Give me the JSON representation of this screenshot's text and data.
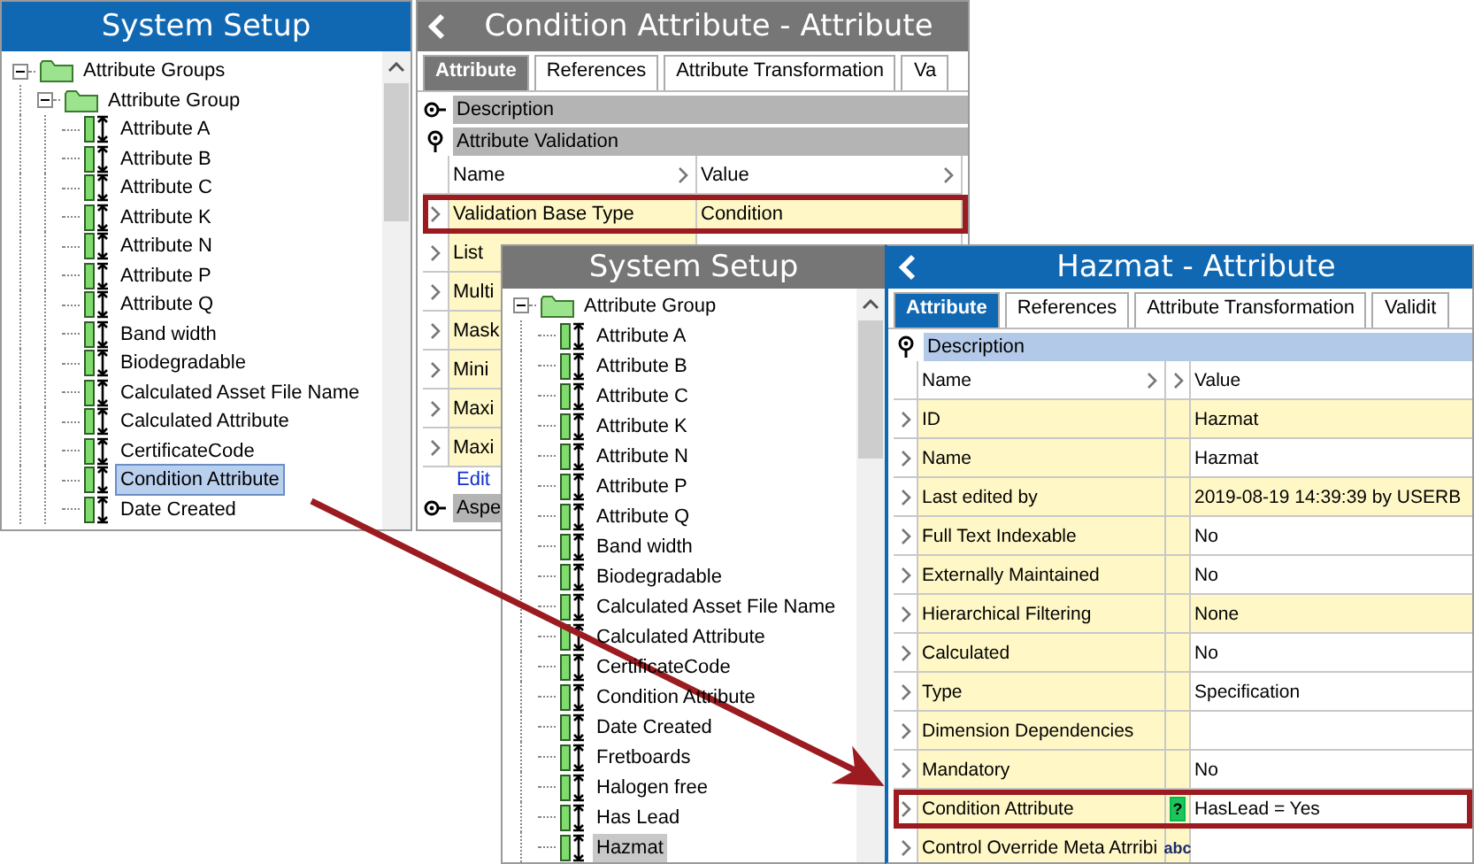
{
  "top_tree": {
    "title": "System Setup",
    "focused": true,
    "items": [
      {
        "kind": "group",
        "label": "Attribute Groups",
        "expanded": true,
        "children": [
          {
            "kind": "group",
            "label": "Attribute Group",
            "expanded": true,
            "children": [
              {
                "kind": "attribute",
                "label": "Attribute A",
                "selected": false
              },
              {
                "kind": "attribute",
                "label": "Attribute B",
                "selected": false
              },
              {
                "kind": "attribute",
                "label": "Attribute C",
                "selected": false
              },
              {
                "kind": "attribute",
                "label": "Attribute K",
                "selected": false
              },
              {
                "kind": "attribute",
                "label": "Attribute N",
                "selected": false
              },
              {
                "kind": "attribute",
                "label": "Attribute P",
                "selected": false
              },
              {
                "kind": "attribute",
                "label": "Attribute Q",
                "selected": false
              },
              {
                "kind": "attribute",
                "label": "Band width",
                "selected": false
              },
              {
                "kind": "attribute",
                "label": "Biodegradable",
                "selected": false
              },
              {
                "kind": "attribute",
                "label": "Calculated Asset File Name",
                "selected": false
              },
              {
                "kind": "attribute",
                "label": "Calculated Attribute",
                "selected": false
              },
              {
                "kind": "attribute",
                "label": "CertificateCode",
                "selected": false
              },
              {
                "kind": "attribute",
                "label": "Condition Attribute",
                "selected": true
              },
              {
                "kind": "attribute",
                "label": "Date Created",
                "selected": false
              }
            ]
          }
        ]
      }
    ]
  },
  "top_editor": {
    "title": "Condition Attribute - Attribute",
    "focused": false,
    "tabs": [
      {
        "label": "Attribute",
        "selected": true
      },
      {
        "label": "References",
        "selected": false
      },
      {
        "label": "Attribute Transformation",
        "selected": false
      },
      {
        "label": "Va",
        "selected": false
      }
    ],
    "sections": [
      {
        "label": "Description",
        "expanded": false
      },
      {
        "label": "Attribute Validation",
        "expanded": true,
        "columns": [
          "Name",
          "Value"
        ],
        "rows": [
          {
            "name": "Validation Base Type",
            "value": "Condition",
            "shaded": true,
            "highlighted": true
          },
          {
            "name": "List",
            "highlighted": false
          },
          {
            "name": "Multi",
            "highlighted": false
          },
          {
            "name": "Mask",
            "highlighted": false
          },
          {
            "name": "Mini",
            "highlighted": false
          },
          {
            "name": "Maxi",
            "highlighted": false
          },
          {
            "name": "Maxi",
            "highlighted": false
          }
        ],
        "link": "Edit"
      },
      {
        "label": "Aspe",
        "expanded": false
      }
    ]
  },
  "bottom_tree": {
    "title": "System Setup",
    "focused": false,
    "items": [
      {
        "kind": "group",
        "label": "Attribute Group",
        "expanded": true,
        "children": [
          {
            "kind": "attribute",
            "label": "Attribute A",
            "selected": false
          },
          {
            "kind": "attribute",
            "label": "Attribute B",
            "selected": false
          },
          {
            "kind": "attribute",
            "label": "Attribute C",
            "selected": false
          },
          {
            "kind": "attribute",
            "label": "Attribute K",
            "selected": false
          },
          {
            "kind": "attribute",
            "label": "Attribute N",
            "selected": false
          },
          {
            "kind": "attribute",
            "label": "Attribute P",
            "selected": false
          },
          {
            "kind": "attribute",
            "label": "Attribute Q",
            "selected": false
          },
          {
            "kind": "attribute",
            "label": "Band width",
            "selected": false
          },
          {
            "kind": "attribute",
            "label": "Biodegradable",
            "selected": false
          },
          {
            "kind": "attribute",
            "label": "Calculated Asset File Name",
            "selected": false
          },
          {
            "kind": "attribute",
            "label": "Calculated Attribute",
            "selected": false
          },
          {
            "kind": "attribute",
            "label": "CertificateCode",
            "selected": false
          },
          {
            "kind": "attribute",
            "label": "Condition Attribute",
            "selected": false
          },
          {
            "kind": "attribute",
            "label": "Date Created",
            "selected": false
          },
          {
            "kind": "attribute",
            "label": "Fretboards",
            "selected": false
          },
          {
            "kind": "attribute",
            "label": "Halogen free",
            "selected": false
          },
          {
            "kind": "attribute",
            "label": "Has Lead",
            "selected": false
          },
          {
            "kind": "attribute",
            "label": "Hazmat",
            "selected": true
          }
        ]
      }
    ]
  },
  "bottom_editor": {
    "title": "Hazmat - Attribute",
    "focused": true,
    "tabs": [
      {
        "label": "Attribute",
        "selected": true
      },
      {
        "label": "References",
        "selected": false
      },
      {
        "label": "Attribute Transformation",
        "selected": false
      },
      {
        "label": "Validit",
        "selected": false
      }
    ],
    "sections": [
      {
        "label": "Description",
        "expanded": true,
        "columns": [
          "Name",
          "Value"
        ],
        "rows": [
          {
            "name": "ID",
            "value": "Hazmat",
            "shaded": true,
            "highlighted": false
          },
          {
            "name": "Name",
            "value": "Hazmat",
            "shaded": false,
            "highlighted": false
          },
          {
            "name": "Last edited by",
            "value": "2019-08-19 14:39:39 by USERB",
            "shaded": true,
            "highlighted": false
          },
          {
            "name": "Full Text Indexable",
            "value": "No",
            "shaded": false,
            "highlighted": false
          },
          {
            "name": "Externally Maintained",
            "value": "No",
            "shaded": false,
            "highlighted": false
          },
          {
            "name": "Hierarchical Filtering",
            "value": "None",
            "shaded": true,
            "highlighted": false
          },
          {
            "name": "Calculated",
            "value": "No",
            "shaded": false,
            "highlighted": false
          },
          {
            "name": "Type",
            "value": "Specification",
            "shaded": false,
            "highlighted": false
          },
          {
            "name": "Dimension Dependencies",
            "shaded": false,
            "highlighted": false
          },
          {
            "name": "Mandatory",
            "value": "No",
            "shaded": false,
            "highlighted": false
          },
          {
            "name": "Condition Attribute",
            "value": "HasLead = Yes",
            "shaded": false,
            "highlighted": true,
            "tag": {
              "kind": "help",
              "text": "?"
            }
          },
          {
            "name": "Control Override Meta Atrribi",
            "shaded": false,
            "highlighted": false,
            "tag": {
              "kind": "type",
              "text": "abc"
            }
          }
        ]
      }
    ]
  }
}
